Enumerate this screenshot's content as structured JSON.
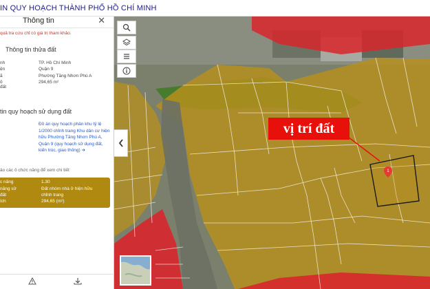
{
  "header": {
    "title": "IN QUY HOẠCH THÀNH PHỐ HỒ CHÍ MINH"
  },
  "panel": {
    "title": "Thông tin",
    "close_icon": "close-icon",
    "disclaimer": "quả tra cứu chỉ có giá trị tham khảo.",
    "parcel_section": "Thông tin thửa đất",
    "parcel_rows": [
      {
        "key": "nh",
        "value": "TP. Hồ Chí Minh"
      },
      {
        "key": "ện",
        "value": "Quận 9"
      },
      {
        "key": "ã",
        "value": "Phường Tăng Nhơn Phú A"
      },
      {
        "key": "ô đất",
        "value": "294,65 m²"
      }
    ],
    "planning_section": "tin quy hoạch sử dụng đất",
    "planning_link": "Đồ án quy hoạch phân khu tỷ lệ 1/2000 chỉnh trang Khu dân cư hiện hữu Phường Tăng Nhơn Phú A, Quận 9 (quy hoạch sử dụng đất, kiến trúc, giao thông)",
    "planning_link_arrow": "➔",
    "note": "ảo các ô chức năng để xem chi tiết",
    "zone_rows": [
      {
        "key": "c năng",
        "value": "1.30"
      },
      {
        "key": "năng sử",
        "value": "Đất nhóm nhà ở hiện hữu"
      },
      {
        "key": "đất",
        "value": "chỉnh trang"
      },
      {
        "key": "ích",
        "value": "294,65 (m²)"
      }
    ]
  },
  "map": {
    "annotation": "vị trí đất",
    "parcel_marker": "1",
    "colors": {
      "residential": "#b8901c",
      "green": "#3f7a22",
      "road_red": "#d8262c",
      "label_bg": "#e8100b",
      "parcel_outline": "#1a1a1a"
    }
  },
  "toolbar": {
    "search_icon": "search-icon",
    "layers_icon": "layers-icon",
    "list_icon": "list-icon",
    "info_icon": "info-icon",
    "collapse_icon": "chevron-left-icon"
  }
}
